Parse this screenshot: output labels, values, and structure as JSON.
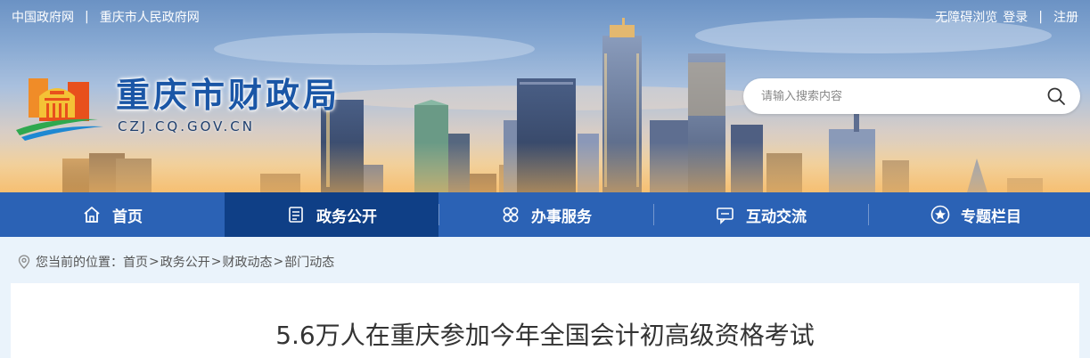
{
  "top_links": {
    "left": [
      "中国政府网",
      "重庆市人民政府网"
    ],
    "separator": "|",
    "accessibility": "无障碍浏览",
    "login": "登录",
    "register": "注册"
  },
  "logo": {
    "title": "重庆市财政局",
    "domain": "CZJ.CQ.GOV.CN"
  },
  "search": {
    "placeholder": "请输入搜索内容"
  },
  "nav": {
    "items": [
      {
        "label": "首页",
        "icon": "home-icon"
      },
      {
        "label": "政务公开",
        "icon": "document-list-icon",
        "active": true
      },
      {
        "label": "办事服务",
        "icon": "services-grid-icon"
      },
      {
        "label": "互动交流",
        "icon": "chat-icon"
      },
      {
        "label": "专题栏目",
        "icon": "star-circle-icon"
      }
    ]
  },
  "breadcrumb": {
    "prefix": "您当前的位置：",
    "items": [
      "首页",
      "政务公开",
      "财政动态",
      "部门动态"
    ],
    "separator": ">"
  },
  "article": {
    "title": "5.6万人在重庆参加今年全国会计初高级资格考试"
  },
  "colors": {
    "nav_bg": "#2b62b5",
    "nav_active": "#0f3f86",
    "logo_blue": "#1a56a6",
    "page_bg": "#eaf3fb"
  }
}
